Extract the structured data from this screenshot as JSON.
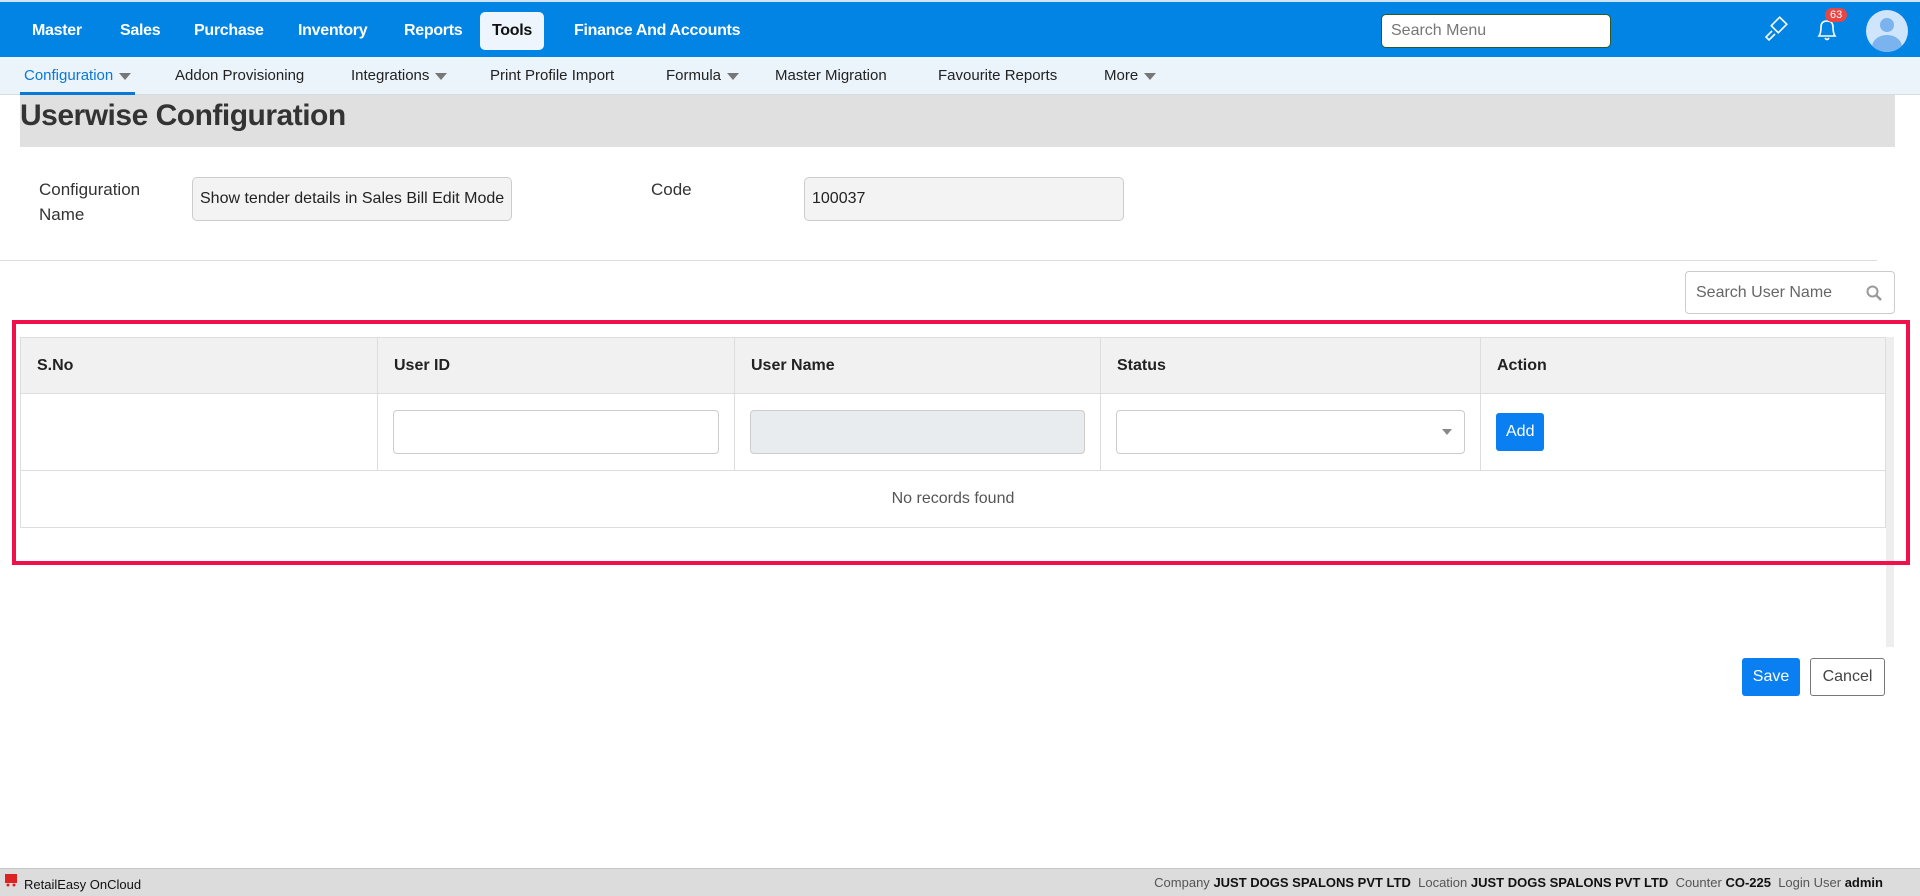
{
  "topnav": {
    "items": [
      "Master",
      "Sales",
      "Purchase",
      "Inventory",
      "Reports",
      "Tools",
      "Finance And Accounts"
    ],
    "active": "Tools",
    "search_placeholder": "Search Menu",
    "notification_count": "63"
  },
  "subnav": {
    "items": [
      "Configuration",
      "Addon Provisioning",
      "Integrations",
      "Print Profile Import",
      "Formula",
      "Master Migration",
      "Favourite Reports",
      "More"
    ]
  },
  "page": {
    "title": "Userwise Configuration",
    "config_name_label": "Configuration Name",
    "config_name_value": "Show tender details in Sales Bill Edit Mode",
    "code_label": "Code",
    "code_value": "100037",
    "search_user_placeholder": "Search User Name"
  },
  "table": {
    "headers": [
      "S.No",
      "User ID",
      "User Name",
      "Status",
      "Action"
    ],
    "add_label": "Add",
    "empty_text": "No records found"
  },
  "actions": {
    "save": "Save",
    "cancel": "Cancel"
  },
  "footer": {
    "app": "RetailEasy OnCloud",
    "company_label": "Company",
    "company": "JUST DOGS SPALONS PVT LTD",
    "location_label": "Location",
    "location": "JUST DOGS SPALONS PVT LTD",
    "counter_label": "Counter",
    "counter": "CO-225",
    "login_label": "Login User",
    "login": "admin"
  },
  "colors": {
    "brand": "#0284e4",
    "highlight": "#f0104c"
  }
}
